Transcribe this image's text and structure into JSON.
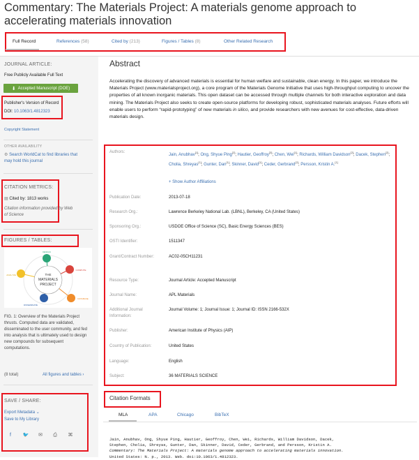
{
  "page": {
    "title": "Commentary: The Materials Project: A materials genome approach to accelerating materials innovation"
  },
  "tabs": [
    {
      "label": "Full Record",
      "count": ""
    },
    {
      "label": "References",
      "count": "(58)"
    },
    {
      "label": "Cited by",
      "count": "(213)"
    },
    {
      "label": "Figures / Tables",
      "count": "(8)"
    },
    {
      "label": "Other Related Research",
      "count": ""
    }
  ],
  "sidebar": {
    "journal_article_heading": "JOURNAL ARTICLE:",
    "free_text": "Free Publicly Available Full Text",
    "accepted_button": "Accepted Manuscript (DOE)",
    "publisher_version": "Publisher's Version of Record",
    "doi_prefix": "DOI:",
    "doi": "10.1063/1.4812323",
    "copyright": "Copyright Statement",
    "other_availability": "OTHER AVAILABILITY",
    "worldcat_line1": "Search WorldCat to find libraries that",
    "worldcat_line2": "may hold this journal",
    "citation_metrics_heading": "CITATION METRICS:",
    "cited_by": "Cited by: 1813 works",
    "citation_info": "Citation information provided by Web of Science",
    "figures_heading": "FIGURES / TABLES:",
    "figure": {
      "center_line1": "THE",
      "center_line2": "MATERIALS",
      "center_line3": "PROJECT",
      "node_top": "DESIGN",
      "node_right_top": "COMPUTE",
      "node_right_bottom": "DATABASE",
      "node_bottom": "DISSEMINATE",
      "node_left": "ANALYZE"
    },
    "fig_caption": "FIG. 1: Overview of the Materials Project thrusts. Computed data are validated, disseminated to the user community, and fed into analysis that is ultimately used to design new compounds for subsequent computations.",
    "total": "(8 total)",
    "all_figures": "All figures and tables",
    "save_share_heading": "SAVE / SHARE:",
    "export_metadata": "Export Metadata",
    "save_library": "Save to My Library"
  },
  "abstract": {
    "heading": "Abstract",
    "text_part1": "Accelerating the discovery of advanced materials is essential for human welfare and sustainable, clean energy. In this paper, we introduce the Materials Project (www.materialsproject.org), a core program of the Materials Genome Initiative that uses high-throughput computing to uncover the properties of all known inorganic materials. This open dataset can be accessed through multiple channels for both interactive exploration and data mining. The Materials Project also seeks to create open-source platforms for developing robust, sophisticated materials analyses. Future efforts will enable users to perform “rapid-prototyping” of new materials",
    "text_italic": "in silico",
    "text_part2": ", and provide researchers with new avenues for cost-effective, data-driven materials design."
  },
  "metadata": {
    "authors_label": "Authors:",
    "authors": [
      {
        "name": "Jain, Anubhav",
        "ref": "[1]"
      },
      {
        "name": "Ong, Shyue Ping",
        "ref": "[2]"
      },
      {
        "name": "Hautier, Geoffroy",
        "ref": "[3]"
      },
      {
        "name": "Chen, Wei",
        "ref": "[1]"
      },
      {
        "name": "Richards, William Davidson",
        "ref": "[2]"
      },
      {
        "name": "Dacek, Stephen",
        "ref": "[2]"
      },
      {
        "name": "Cholia, Shreyas",
        "ref": "[1]"
      },
      {
        "name": "Gunter, Dan",
        "ref": "[1]"
      },
      {
        "name": "Skinner, David",
        "ref": "[1]"
      },
      {
        "name": "Ceder, Gerbrand",
        "ref": "[2]"
      },
      {
        "name": "Persson, Kristin A.",
        "ref": "[1]"
      }
    ],
    "show_affiliations": "+ Show Author Affiliations",
    "rows": [
      {
        "label": "Publication Date:",
        "value": "2013-07-18"
      },
      {
        "label": "Research Org.:",
        "value": "Lawrence Berkeley National Lab. (LBNL), Berkeley, CA (United States)"
      },
      {
        "label": "Sponsoring Org.:",
        "value": "USDOE Office of Science (SC), Basic Energy Sciences (BES)"
      },
      {
        "label": "OSTI Identifier:",
        "value": "1511347"
      },
      {
        "label": "Grant/Contract Number:",
        "value": "AC02-05CH11231"
      },
      {
        "label": "Resource Type:",
        "value": "Journal Article: Accepted Manuscript"
      },
      {
        "label": "Journal Name:",
        "value": "APL Materials"
      },
      {
        "label": "Additional Journal Information:",
        "value": "Journal Volume: 1; Journal Issue: 1; Journal ID: ISSN 2166-532X"
      },
      {
        "label": "Publisher:",
        "value": "American Institute of Physics (AIP)"
      },
      {
        "label": "Country of Publication:",
        "value": "United States"
      },
      {
        "label": "Language:",
        "value": "English"
      },
      {
        "label": "Subject:",
        "value": "36 MATERIALS SCIENCE"
      }
    ]
  },
  "citation": {
    "heading": "Citation Formats",
    "tabs": [
      "MLA",
      "APA",
      "Chicago",
      "BibTeX"
    ],
    "line1": "Jain, Anubhav, Ong, Shyue Ping, Hautier, Geoffroy, Chen, Wei, Richards, William Davidson, Dacek,",
    "line2": "Stephen, Cholia, Shreyas, Gunter, Dan, Skinner, David, Ceder, Gerbrand, and Persson, Kristin A.",
    "line3": "Commentary: The Materials Project: A materials genome approach to accelerating materials innovation.",
    "line4": "United States: N. p., 2013. Web. doi:10.1063/1.4812323."
  },
  "colors": {
    "link": "#3a6fb0",
    "highlight": "#e8141e",
    "button": "#6aa33e"
  }
}
